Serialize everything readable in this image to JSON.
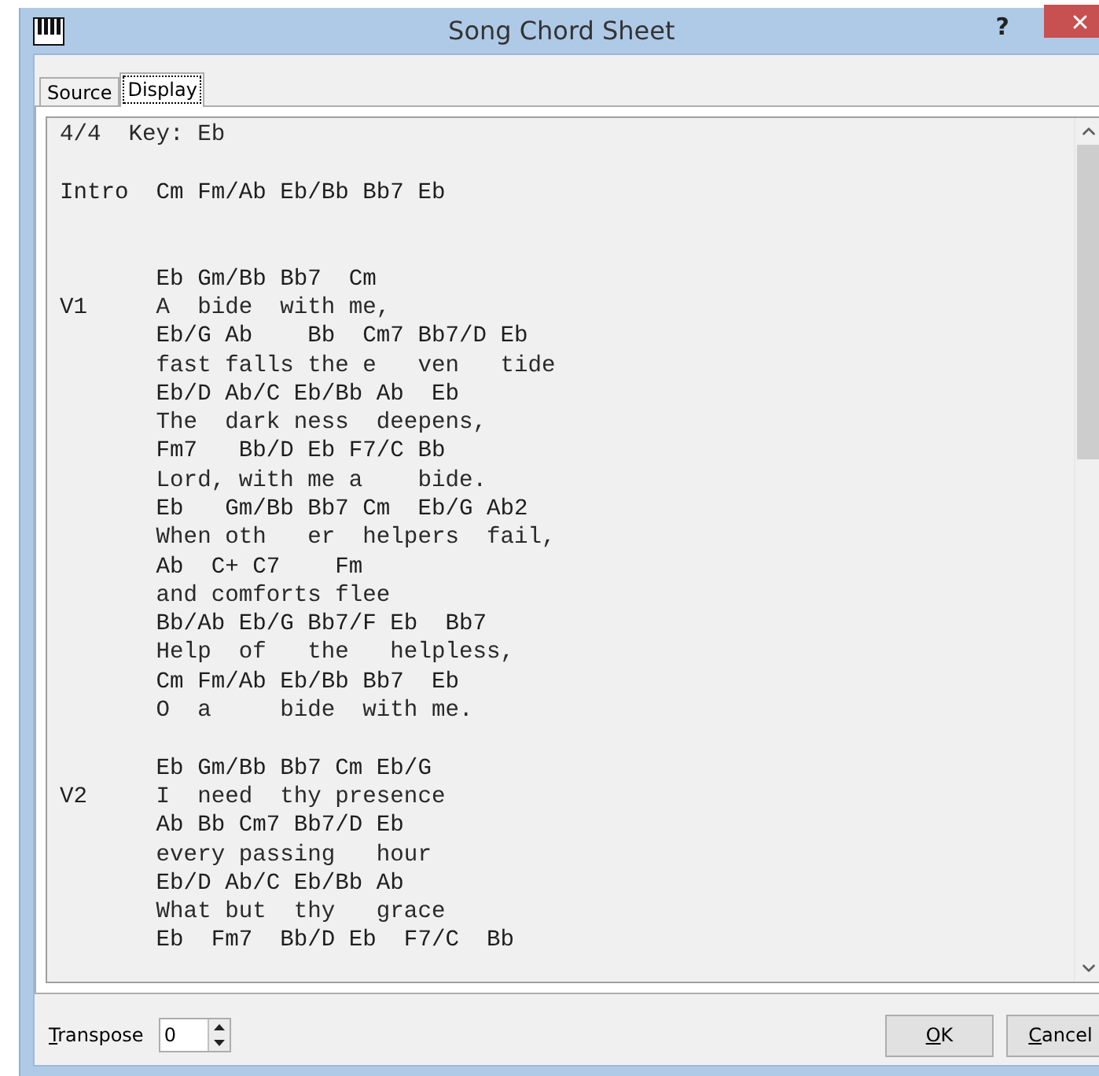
{
  "window": {
    "title": "Song Chord Sheet",
    "help": "?"
  },
  "tabs": [
    {
      "label": "Source",
      "selected": false
    },
    {
      "label": "Display",
      "selected": true
    }
  ],
  "sheet": {
    "lines": [
      {
        "kind": "header",
        "text": "4/4  Key: Eb"
      },
      {
        "kind": "blank"
      },
      {
        "kind": "chords",
        "label": "Intro",
        "text": "Cm Fm/Ab Eb/Bb Bb7 Eb"
      },
      {
        "kind": "blank"
      },
      {
        "kind": "blank"
      },
      {
        "kind": "chords",
        "text": "Eb Gm/Bb Bb7  Cm"
      },
      {
        "kind": "lyrics",
        "label": "V1",
        "text": "A  bide  with me,"
      },
      {
        "kind": "chords",
        "text": "Eb/G Ab    Bb  Cm7 Bb7/D Eb"
      },
      {
        "kind": "lyrics",
        "text": "fast falls the e   ven   tide"
      },
      {
        "kind": "chords",
        "text": "Eb/D Ab/C Eb/Bb Ab  Eb"
      },
      {
        "kind": "lyrics",
        "text": "The  dark ness  deepens,"
      },
      {
        "kind": "chords",
        "text": "Fm7   Bb/D Eb F7/C Bb"
      },
      {
        "kind": "lyrics",
        "text": "Lord, with me a    bide."
      },
      {
        "kind": "chords",
        "text": "Eb   Gm/Bb Bb7 Cm  Eb/G Ab2"
      },
      {
        "kind": "lyrics",
        "text": "When oth   er  helpers  fail,"
      },
      {
        "kind": "chords",
        "text": "Ab  C+ C7    Fm"
      },
      {
        "kind": "lyrics",
        "text": "and comforts flee"
      },
      {
        "kind": "chords",
        "text": "Bb/Ab Eb/G Bb7/F Eb  Bb7"
      },
      {
        "kind": "lyrics",
        "text": "Help  of   the   helpless,"
      },
      {
        "kind": "chords",
        "text": "Cm Fm/Ab Eb/Bb Bb7  Eb"
      },
      {
        "kind": "lyrics",
        "text": "O  a     bide  with me."
      },
      {
        "kind": "blank"
      },
      {
        "kind": "chords",
        "text": "Eb Gm/Bb Bb7 Cm Eb/G"
      },
      {
        "kind": "lyrics",
        "label": "V2",
        "text": "I  need  thy presence"
      },
      {
        "kind": "chords",
        "text": "Ab Bb Cm7 Bb7/D Eb"
      },
      {
        "kind": "lyrics",
        "text": "every passing   hour"
      },
      {
        "kind": "chords",
        "text": "Eb/D Ab/C Eb/Bb Ab"
      },
      {
        "kind": "lyrics",
        "text": "What but  thy   grace"
      },
      {
        "kind": "chords",
        "text": "Eb  Fm7  Bb/D Eb  F7/C  Bb"
      }
    ]
  },
  "transpose": {
    "label": "Transpose",
    "value": "0"
  },
  "buttons": [
    {
      "label": "OK"
    },
    {
      "label": "Cancel"
    }
  ]
}
